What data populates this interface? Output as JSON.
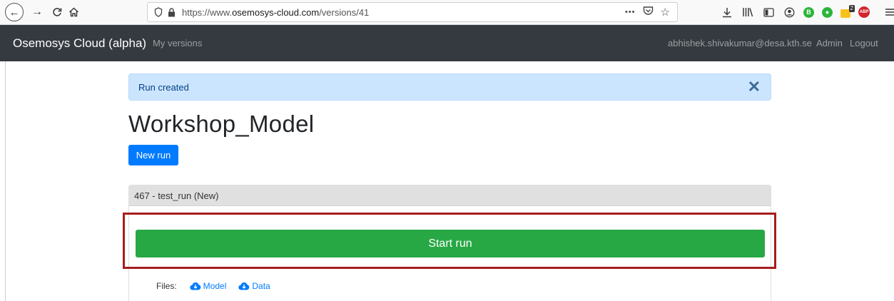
{
  "browser": {
    "url_prefix": "https://www.",
    "url_host": "osemosys-cloud.com",
    "url_path": "/versions/41",
    "more_label": "•••",
    "icons": [
      "back-icon",
      "forward-icon",
      "reload-icon",
      "home-icon",
      "shield-icon",
      "lock-icon",
      "pocket-icon",
      "bookmark-star-icon",
      "download-icon",
      "library-icon",
      "sidebar-icon",
      "account-icon",
      "extension-green-icon",
      "extension-green2-icon",
      "extension-badge-icon",
      "adblock-icon",
      "menu-icon"
    ],
    "badge_count": "2",
    "abp_label": "ABP",
    "green_ext_label": "B"
  },
  "navbar": {
    "brand": "Osemosys Cloud (alpha)",
    "my_versions": "My versions",
    "user_email": "abhishek.shivakumar@desa.kth.se",
    "admin": "Admin",
    "logout": "Logout",
    "bg_color": "#343a40"
  },
  "alert": {
    "message": "Run created",
    "close_symbol": "✕",
    "color": "#cce5ff"
  },
  "page": {
    "title": "Workshop_Model",
    "new_run_label": "New run"
  },
  "run_card": {
    "header": "467 - test_run (New)",
    "start_label": "Start run",
    "start_color": "#28a745",
    "highlight_color": "#a61d1d",
    "files_label": "Files:",
    "model_link": "Model",
    "data_link": "Data"
  }
}
